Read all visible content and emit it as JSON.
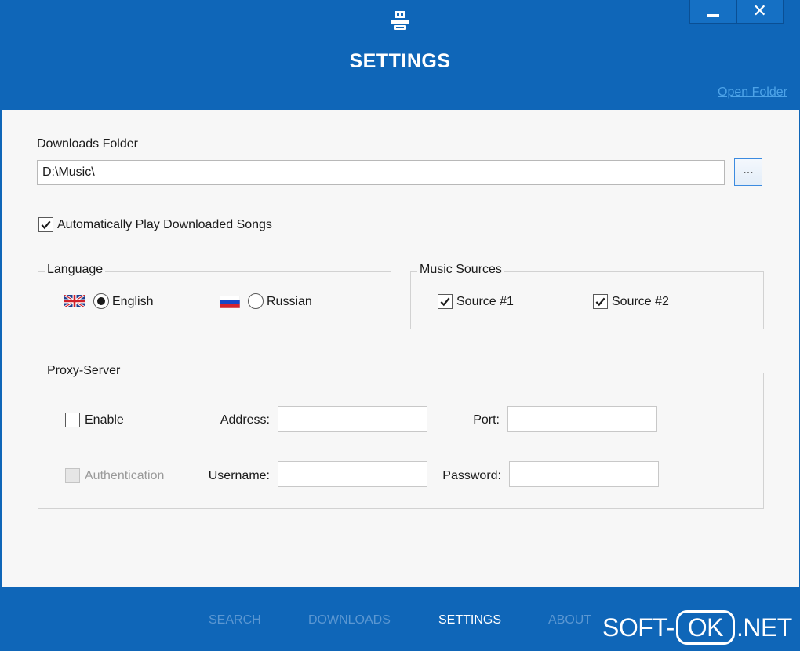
{
  "window": {
    "title": "SETTINGS",
    "open_folder_link": "Open Folder",
    "minimize_icon": "minimize-icon",
    "close_icon": "close-icon",
    "close_glyph": "✕"
  },
  "settings": {
    "downloads_folder_label": "Downloads Folder",
    "downloads_folder_value": "D:\\Music\\",
    "browse_label": "...",
    "auto_play_label": "Automatically Play Downloaded Songs",
    "auto_play_checked": true
  },
  "language": {
    "title": "Language",
    "options": [
      {
        "label": "English",
        "flag": "uk-flag-icon",
        "selected": true
      },
      {
        "label": "Russian",
        "flag": "russia-flag-icon",
        "selected": false
      }
    ]
  },
  "music_sources": {
    "title": "Music Sources",
    "items": [
      {
        "label": "Source #1",
        "checked": true
      },
      {
        "label": "Source #2",
        "checked": true
      }
    ]
  },
  "proxy": {
    "title": "Proxy-Server",
    "enable_label": "Enable",
    "enable_checked": false,
    "auth_label": "Authentication",
    "auth_checked": false,
    "auth_disabled": true,
    "address_label": "Address:",
    "address_value": "",
    "port_label": "Port:",
    "port_value": "",
    "username_label": "Username:",
    "username_value": "",
    "password_label": "Password:",
    "password_value": ""
  },
  "nav": {
    "items": [
      {
        "label": "SEARCH",
        "active": false
      },
      {
        "label": "DOWNLOADS",
        "active": false
      },
      {
        "label": "SETTINGS",
        "active": true
      },
      {
        "label": "ABOUT",
        "active": false
      }
    ]
  },
  "watermark": {
    "left": "SOFT-",
    "boxed": "OK",
    "right": ".NET"
  },
  "colors": {
    "brand_blue": "#0f66b8",
    "content_bg": "#f7f7f7",
    "nav_inactive": "#5b97d2",
    "nav_active": "#ffffff",
    "link": "#4da3e8"
  }
}
